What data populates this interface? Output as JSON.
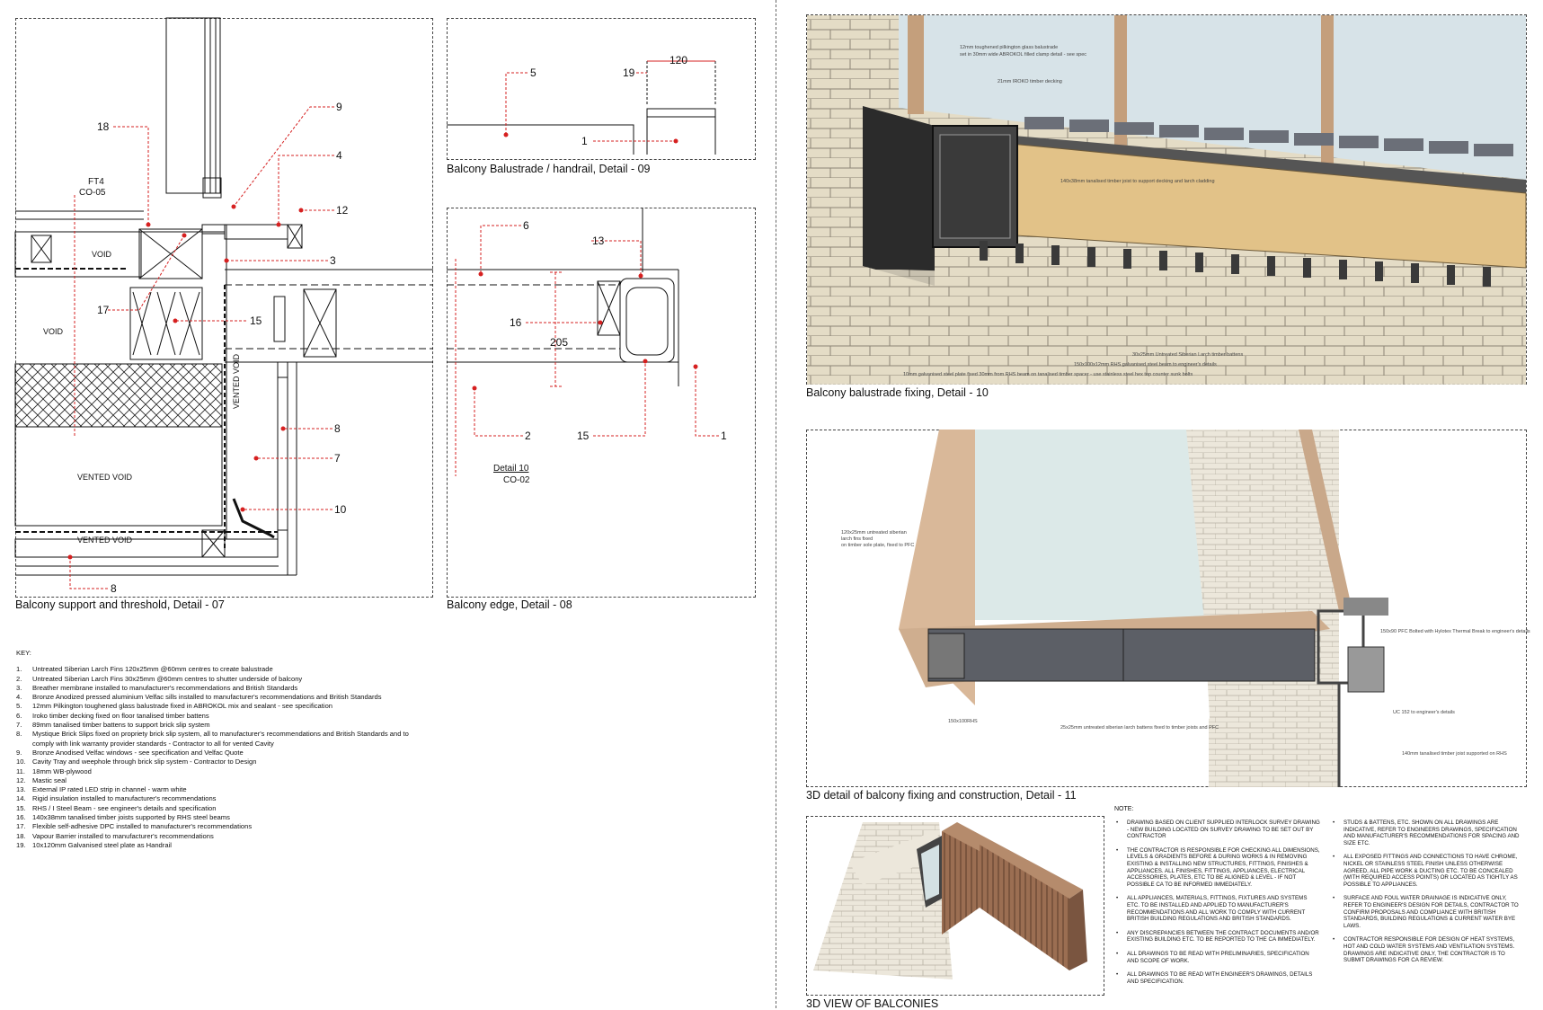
{
  "detail07": {
    "caption": "Balcony support and threshold, Detail - 07",
    "callouts": [
      "18",
      "9",
      "4",
      "12",
      "3",
      "17",
      "15",
      "8",
      "7",
      "10",
      "8"
    ],
    "tag_ft4": "FT4",
    "tag_co05": "CO-05",
    "labels": {
      "void1": "VOID",
      "void2": "VOID",
      "vented_void_vertical": "VENTED VOID",
      "vented_void_main": "VENTED VOID",
      "vented_void_bottom": "VENTED VOID"
    }
  },
  "detail09": {
    "caption": "Balcony Balustrade / handrail, Detail - 09",
    "callouts": [
      "5",
      "19",
      "120",
      "1"
    ]
  },
  "detail08": {
    "caption": "Balcony edge, Detail - 08",
    "callouts": [
      "6",
      "13",
      "16",
      "205",
      "2",
      "15",
      "1"
    ],
    "ref_detail": "Detail 10",
    "ref_sheet": "CO-02"
  },
  "detail10": {
    "caption": "Balcony balustrade fixing, Detail - 10",
    "annotations": [
      "12mm toughened pilkington glass balustrade",
      "set in 30mm wide ABROKOL filled clamp detail - see spec",
      "21mm IROKO timber decking",
      "140x38mm tanalised timber joist to support decking and larch cladding",
      "30x25mm Untreated Siberian Larch timber battens",
      "150x100x12mm RHS galvanised steel beam to engineer's details",
      "10mm galvanised steel plate fixed 30mm from RHS beam on tanalised timber spacer - use stainless steel hex top counter sunk bolts"
    ]
  },
  "detail11": {
    "caption": "3D detail of balcony fixing and construction, Detail - 11",
    "annotations": [
      "120x25mm untreated siberian",
      "larch fins fixed",
      "on timber sole plate, fixed to PFC",
      "150x90 PFC Bolted with Hylotex Thermal Break to engineer's details",
      "150x100RHS",
      "25x25mm untreated siberian larch battens fixed to timber joists and PFC",
      "UC 152 to engineer's details",
      "140mm tanalised timber joist supported on RHS"
    ]
  },
  "view3d": {
    "caption": "3D VIEW OF BALCONIES"
  },
  "key": {
    "title": "KEY:",
    "items": [
      {
        "n": "1.",
        "t": "Untreated Siberian Larch Fins 120x25mm @60mm centres to create balustrade"
      },
      {
        "n": "2.",
        "t": "Untreated Siberian Larch Fins 30x25mm @60mm centres to shutter underside of balcony"
      },
      {
        "n": "3.",
        "t": "Breather membrane installed to manufacturer's recommendations and British Standards"
      },
      {
        "n": "4.",
        "t": "Bronze Anodized pressed aluminium Velfac sills installed to manufacturer's recommendations and British Standards"
      },
      {
        "n": "5.",
        "t": "12mm Pilkington toughened glass balustrade fixed in ABROKOL mix and sealant - see specification"
      },
      {
        "n": "6.",
        "t": "Iroko timber decking fixed on floor tanalised timber battens"
      },
      {
        "n": "7.",
        "t": "89mm tanalised timber battens to support brick slip system"
      },
      {
        "n": "8.",
        "t": "Mystique Brick Slips fixed on propriety brick slip system, all to manufacturer's recommendations and British Standards and to"
      },
      {
        "n": "",
        "t": "comply with link warranty provider standards - Contractor to all for vented Cavity"
      },
      {
        "n": "9.",
        "t": "Bronze Anodised Velfac windows - see specification and Velfac Quote"
      },
      {
        "n": "10.",
        "t": "Cavity Tray and weephole through brick slip system - Contractor to Design"
      },
      {
        "n": "11.",
        "t": "18mm WB-plywood"
      },
      {
        "n": "12.",
        "t": "Mastic seal"
      },
      {
        "n": "13.",
        "t": "External IP rated LED strip in channel - warm white"
      },
      {
        "n": "14.",
        "t": "Rigid insulation installed to manufacturer's recommendations"
      },
      {
        "n": "15.",
        "t": "RHS / I Steel Beam - see engineer's details and specification"
      },
      {
        "n": "16.",
        "t": "140x38mm tanalised timber joists supported by RHS steel beams"
      },
      {
        "n": "17.",
        "t": "Flexible self-adhesive DPC installed to manufacturer's recommendations"
      },
      {
        "n": "18.",
        "t": "Vapour Barrier installed to manufacturer's recommendations"
      },
      {
        "n": "19.",
        "t": "10x120mm Galvanised steel plate as Handrail"
      }
    ]
  },
  "notes": {
    "title": "NOTE:",
    "col1": [
      "Drawing based on client supplied interlock survey drawing - new building located on survey drawing to be set out by contractor",
      "The contractor is responsible for checking all dimensions, levels & gradients before & during works & in removing existing & installing new structures, fittings, finishes & appliances. All finishes, fittings, appliances, electrical accessories, plates, etc to be aligned & level - if not possible CA to be informed immediately.",
      "All appliances, materials, fittings, fixtures and systems etc. to be installed and applied to manufacturer's recommendations and all work to comply with current British Building Regulations and British Standards.",
      "Any discrepancies between the contract documents and/or existing building etc. to be reported to the CA immediately.",
      "All drawings to be read with preliminaries, specification and scope of work.",
      "All drawings to be read with engineer's drawings, details and specification."
    ],
    "col2": [
      "Studs & battens, etc. shown on all drawings are indicative, refer to engineers drawings, specification and manufacturer's recommendations for spacing and size etc.",
      "All exposed fittings and connections to have chrome, nickel or stainless steel finish unless otherwise agreed, all pipe work & ducting etc. to be concealed (with required access points) or located as tightly as possible to appliances.",
      "Surface and foul water drainage is indicative only, refer to engineer's design for details, contractor to confirm proposals and compliance with British Standards, Building Regulations & current water bye laws.",
      "Contractor responsible for design of heat systems, hot and cold water systems and ventilation systems. Drawings are indicative only, the contractor is to submit drawings for CA review."
    ]
  }
}
